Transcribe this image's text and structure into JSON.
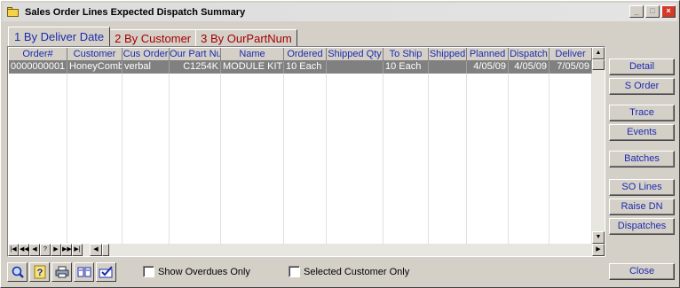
{
  "window": {
    "title": "Sales Order Lines Expected Dispatch Summary"
  },
  "tabs": [
    {
      "label": "1 By Deliver Date",
      "active": true
    },
    {
      "label": "2 By Customer",
      "active": false
    },
    {
      "label": "3 By OurPartNum",
      "active": false
    }
  ],
  "grid": {
    "columns": [
      "Order#",
      "Customer",
      "Cus Order",
      "Our Part Num",
      "Name",
      "Ordered",
      "Shipped Qty",
      "To Ship",
      "Shipped",
      "Planned",
      "Dispatch",
      "Deliver"
    ],
    "rows": [
      [
        "0000000001",
        "HoneyComb",
        "verbal",
        "C1254K",
        "MODULE KIT",
        "10 Each",
        "",
        "10 Each",
        "",
        "4/05/09",
        "4/05/09",
        "7/05/09"
      ]
    ]
  },
  "side_buttons": {
    "detail": "Detail",
    "s_order": "S Order",
    "trace": "Trace",
    "events": "Events",
    "batches": "Batches",
    "so_lines": "SO Lines",
    "raise_dn": "Raise DN",
    "dispatches": "Dispatches",
    "close": "Close"
  },
  "options": {
    "show_overdues_only": "Show Overdues Only",
    "selected_customer_only": "Selected Customer Only"
  },
  "nav_buttons": [
    "|◀",
    "◀◀",
    "◀",
    "?",
    "▶",
    "▶▶",
    "▶|"
  ],
  "colors": {
    "label_blue": "#1c2bb0",
    "tab_red": "#a40000",
    "selected_row": "#808080"
  }
}
